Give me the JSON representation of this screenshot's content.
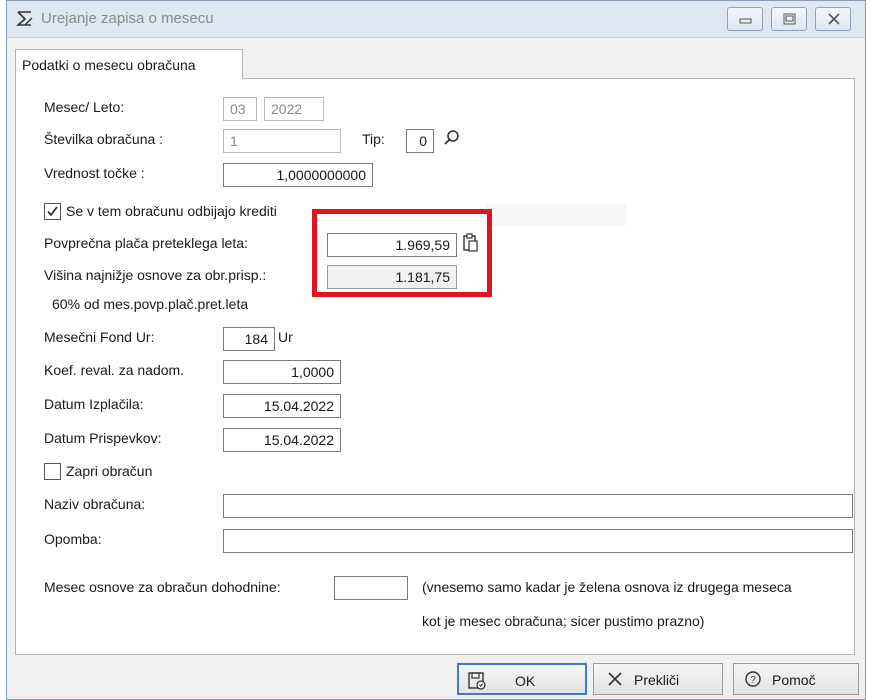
{
  "window": {
    "title": "Urejanje zapisa o mesecu"
  },
  "tab": {
    "label": "Podatki o mesecu obračuna"
  },
  "form": {
    "mesec_leto_label": "Mesec/ Leto:",
    "mesec_value": "03",
    "leto_value": "2022",
    "stevilka_label": "Številka obračuna :",
    "stevilka_value": "1",
    "tip_label": "Tip:",
    "tip_value": "0",
    "vrednost_label": "Vrednost točke :",
    "vrednost_value": "1,0000000000",
    "krediti_label": "Se v tem obračunu odbijajo krediti",
    "krediti_checked": true,
    "povprecna_label": "Povprečna plača preteklega leta:",
    "povprecna_value": "1.969,59",
    "visina_label": "Višina najnižje osnove za obr.prisp.:",
    "visina_value": "1.181,75",
    "visina_note": "60% od mes.povp.plač.pret.leta",
    "fond_label": "Mesečni Fond Ur:",
    "fond_value": "184",
    "fond_unit": "Ur",
    "koef_label": "Koef. reval. za nadom.",
    "koef_value": "1,0000",
    "datum_izplacila_label": "Datum Izplačila:",
    "datum_izplacila_value": "15.04.2022",
    "datum_prispevkov_label": "Datum Prispevkov:",
    "datum_prispevkov_value": "15.04.2022",
    "zapri_label": "Zapri obračun",
    "zapri_checked": false,
    "naziv_label": "Naziv obračuna:",
    "naziv_value": "",
    "opomba_label": "Opomba:",
    "opomba_value": "",
    "mesec_osnove_label": "Mesec osnove za obračun dohodnine:",
    "mesec_osnove_value": "",
    "note_line1": "(vnesemo samo kadar je želena osnova iz drugega meseca",
    "note_line2": "kot je mesec obračuna; sicer pustimo prazno)"
  },
  "buttons": {
    "ok": "OK",
    "cancel": "Prekliči",
    "help": "Pomoč"
  },
  "colors": {
    "highlight": "#e0141e",
    "accent": "#3d7cc9"
  }
}
